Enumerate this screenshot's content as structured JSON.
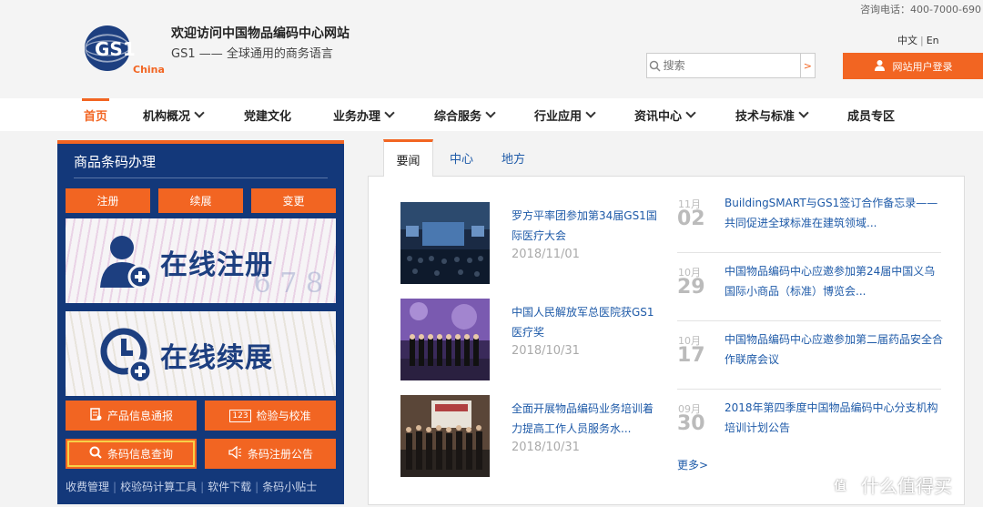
{
  "header": {
    "title": "欢迎访问中国物品编码中心网站",
    "subtitle": "GS1 —— 全球通用的商务语言",
    "hotline": "咨询电话：400-7000-690",
    "logo_text": "GS1",
    "logo_sub": "China",
    "lang_zh": "中文",
    "lang_sep": "|",
    "lang_en": "En",
    "search_placeholder": "搜索",
    "search_go": ">",
    "login_label": "网站用户登录"
  },
  "nav": {
    "items": [
      {
        "label": "首页"
      },
      {
        "label": "机构概况"
      },
      {
        "label": "党建文化"
      },
      {
        "label": "业务办理"
      },
      {
        "label": "综合服务"
      },
      {
        "label": "行业应用"
      },
      {
        "label": "资讯中心"
      },
      {
        "label": "技术与标准"
      },
      {
        "label": "成员专区"
      }
    ]
  },
  "left_panel": {
    "title": "商品条码办理",
    "buttons": [
      "注册",
      "续展",
      "变更"
    ],
    "banner1": "在线注册",
    "banner2": "在线续展",
    "banner_faint": "6 7 8",
    "tools": [
      {
        "label": "产品信息通报"
      },
      {
        "label": "检验与校准",
        "badge": "123"
      },
      {
        "label": "条码信息查询"
      },
      {
        "label": "条码注册公告"
      }
    ],
    "links": [
      "收费管理",
      "校验码计算工具",
      "软件下载",
      "条码小贴士"
    ],
    "link_sep": "|"
  },
  "tabs": [
    "要闻",
    "中心",
    "地方"
  ],
  "news_left": [
    {
      "title": "罗方平率团参加第34届GS1国际医疗大会",
      "date": "2018/11/01"
    },
    {
      "title": "中国人民解放军总医院获GS1医疗奖",
      "date": "2018/10/31"
    },
    {
      "title": "全面开展物品编码业务培训着力提高工作人员服务水...",
      "date": "2018/10/31"
    }
  ],
  "news_right": [
    {
      "month": "11月",
      "day": "02",
      "title": "BuildingSMART与GS1签订合作备忘录——共同促进全球标准在建筑领域..."
    },
    {
      "month": "10月",
      "day": "29",
      "title": "中国物品编码中心应邀参加第24届中国义乌国际小商品（标准）博览会..."
    },
    {
      "month": "10月",
      "day": "17",
      "title": "中国物品编码中心应邀参加第二届药品安全合作联席会议"
    },
    {
      "month": "09月",
      "day": "30",
      "title": "2018年第四季度中国物品编码中心分支机构培训计划公告"
    }
  ],
  "more_label": "更多>",
  "watermark": {
    "icon": "值",
    "text": "什么值得买"
  },
  "colors": {
    "accent": "#f26522",
    "navy": "#13387a",
    "link": "#1e5aa8"
  }
}
